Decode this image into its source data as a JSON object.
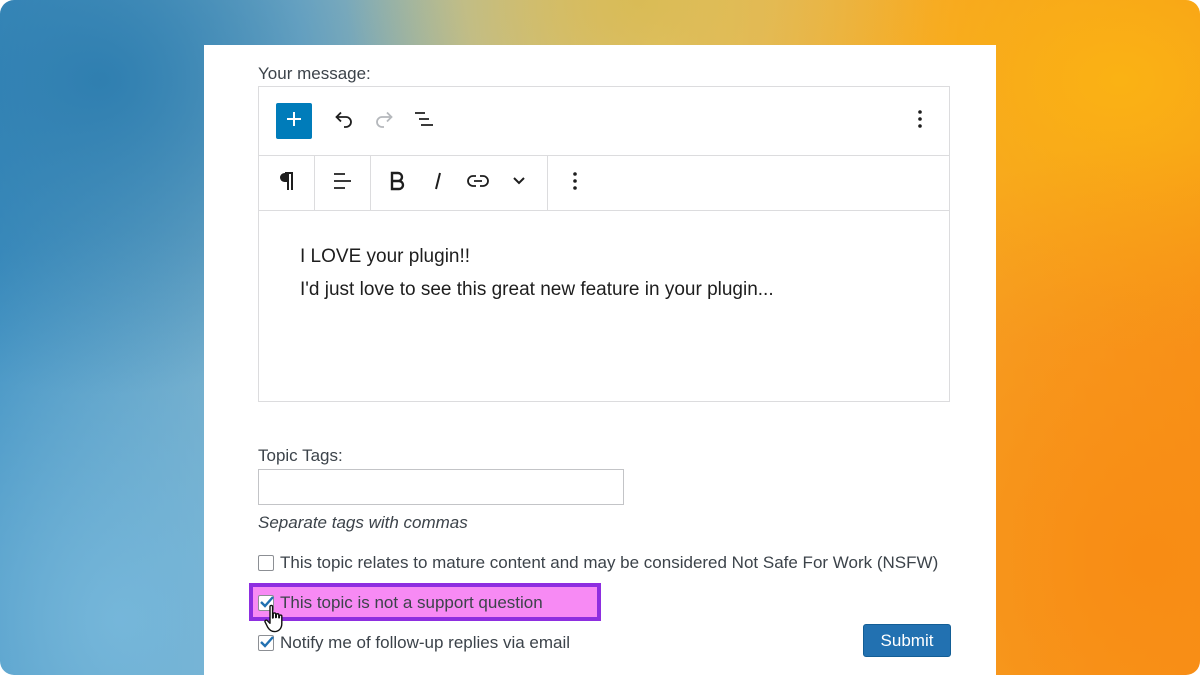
{
  "form": {
    "message_label": "Your message:",
    "editor": {
      "lines": [
        "I LOVE your plugin!!",
        "I'd just love to see this great new feature in your plugin..."
      ]
    },
    "tags": {
      "label": "Topic Tags:",
      "value": "",
      "hint": "Separate tags with commas"
    },
    "checkboxes": [
      {
        "label": "This topic relates to mature content and may be considered Not Safe For Work (NSFW)",
        "checked": false
      },
      {
        "label": "This topic is not a support question",
        "checked": true
      },
      {
        "label": "Notify me of follow-up replies via email",
        "checked": true
      }
    ],
    "submit_label": "Submit"
  },
  "colors": {
    "accent": "#007cba",
    "submit": "#2271b1",
    "highlight_fill": "#f78af4",
    "highlight_border": "#8e2ee0"
  },
  "icons": {
    "toolbar_top": [
      "plus-icon",
      "undo-icon",
      "redo-icon",
      "list-view-icon",
      "more-options-icon"
    ],
    "toolbar_block": [
      "paragraph-icon",
      "align-icon",
      "bold-icon",
      "italic-icon",
      "link-icon",
      "chevron-down-icon",
      "more-options-icon"
    ]
  }
}
